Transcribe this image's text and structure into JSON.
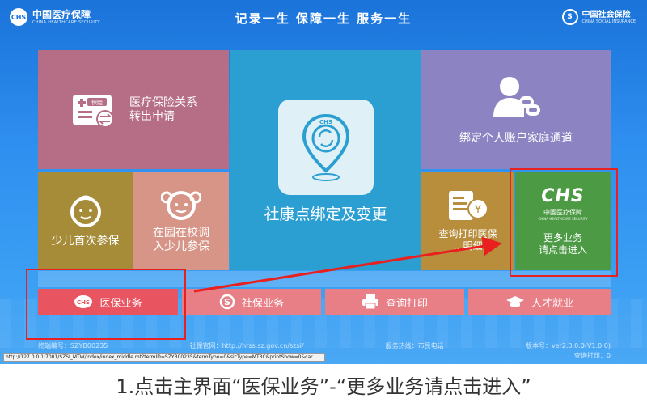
{
  "header": {
    "logo_mark": "CHS",
    "logo_title": "中国医疗保障",
    "logo_subtitle": "CHINA HEALTHCARE SECURITY",
    "slogan": "记录一生   保障一生   服务一生",
    "right_mark": "S",
    "right_title": "中国社会保险",
    "right_subtitle": "CHINA SOCIAL INSURANCE"
  },
  "tiles": {
    "transfer": {
      "badge": "保险",
      "label_line1": "医疗保险关系",
      "label_line2": "转出申请",
      "icon": "insurance-card-transfer-icon"
    },
    "bind": {
      "label": "社康点绑定及变更",
      "icon": "location-pin-refresh-icon",
      "badge": "CHS"
    },
    "family": {
      "label": "绑定个人账户家庭通道",
      "icon": "person-link-icon"
    },
    "child": {
      "label": "少儿首次参保",
      "icon": "baby-face-icon"
    },
    "kinder": {
      "label_line1": "在园在校调",
      "label_line2": "入少儿参保",
      "icon": "girl-face-icon"
    },
    "print": {
      "label_line1": "查询打印医保",
      "label_line2": "…明细",
      "icon": "receipt-yuan-icon"
    },
    "more": {
      "brand": "CHS",
      "brand_cn": "中国医疗保障",
      "brand_en": "CHINA HEALTHCARE SECURITY",
      "label_line1": "更多业务",
      "label_line2": "请点击进入"
    }
  },
  "nav": {
    "medical": "医保业务",
    "social": "社保业务",
    "print": "查询打印",
    "talent": "人才就业"
  },
  "footer": {
    "terminal": "终端编号：SZYB00235",
    "website": "社保官网：http://hrss.sz.gov.cn/szsi/",
    "hotline": "服务热线：市民电话",
    "version": "版本号：ver2.0.0.0(V1.0.0)",
    "print_count": "查询打印：0"
  },
  "status_url": "http://127.0.0.1:7001/SZSI_MTW/index/index_middle.mt?termID=SZYB00235&termType=0&sicType=MT3C&printShow=0&car...",
  "caption": "1.点击主界面“医保业务”-“更多业务请点击进入”",
  "colors": {
    "highlight": "#e82020",
    "more_tile": "#4c9a44",
    "medical_btn": "#e85561"
  }
}
